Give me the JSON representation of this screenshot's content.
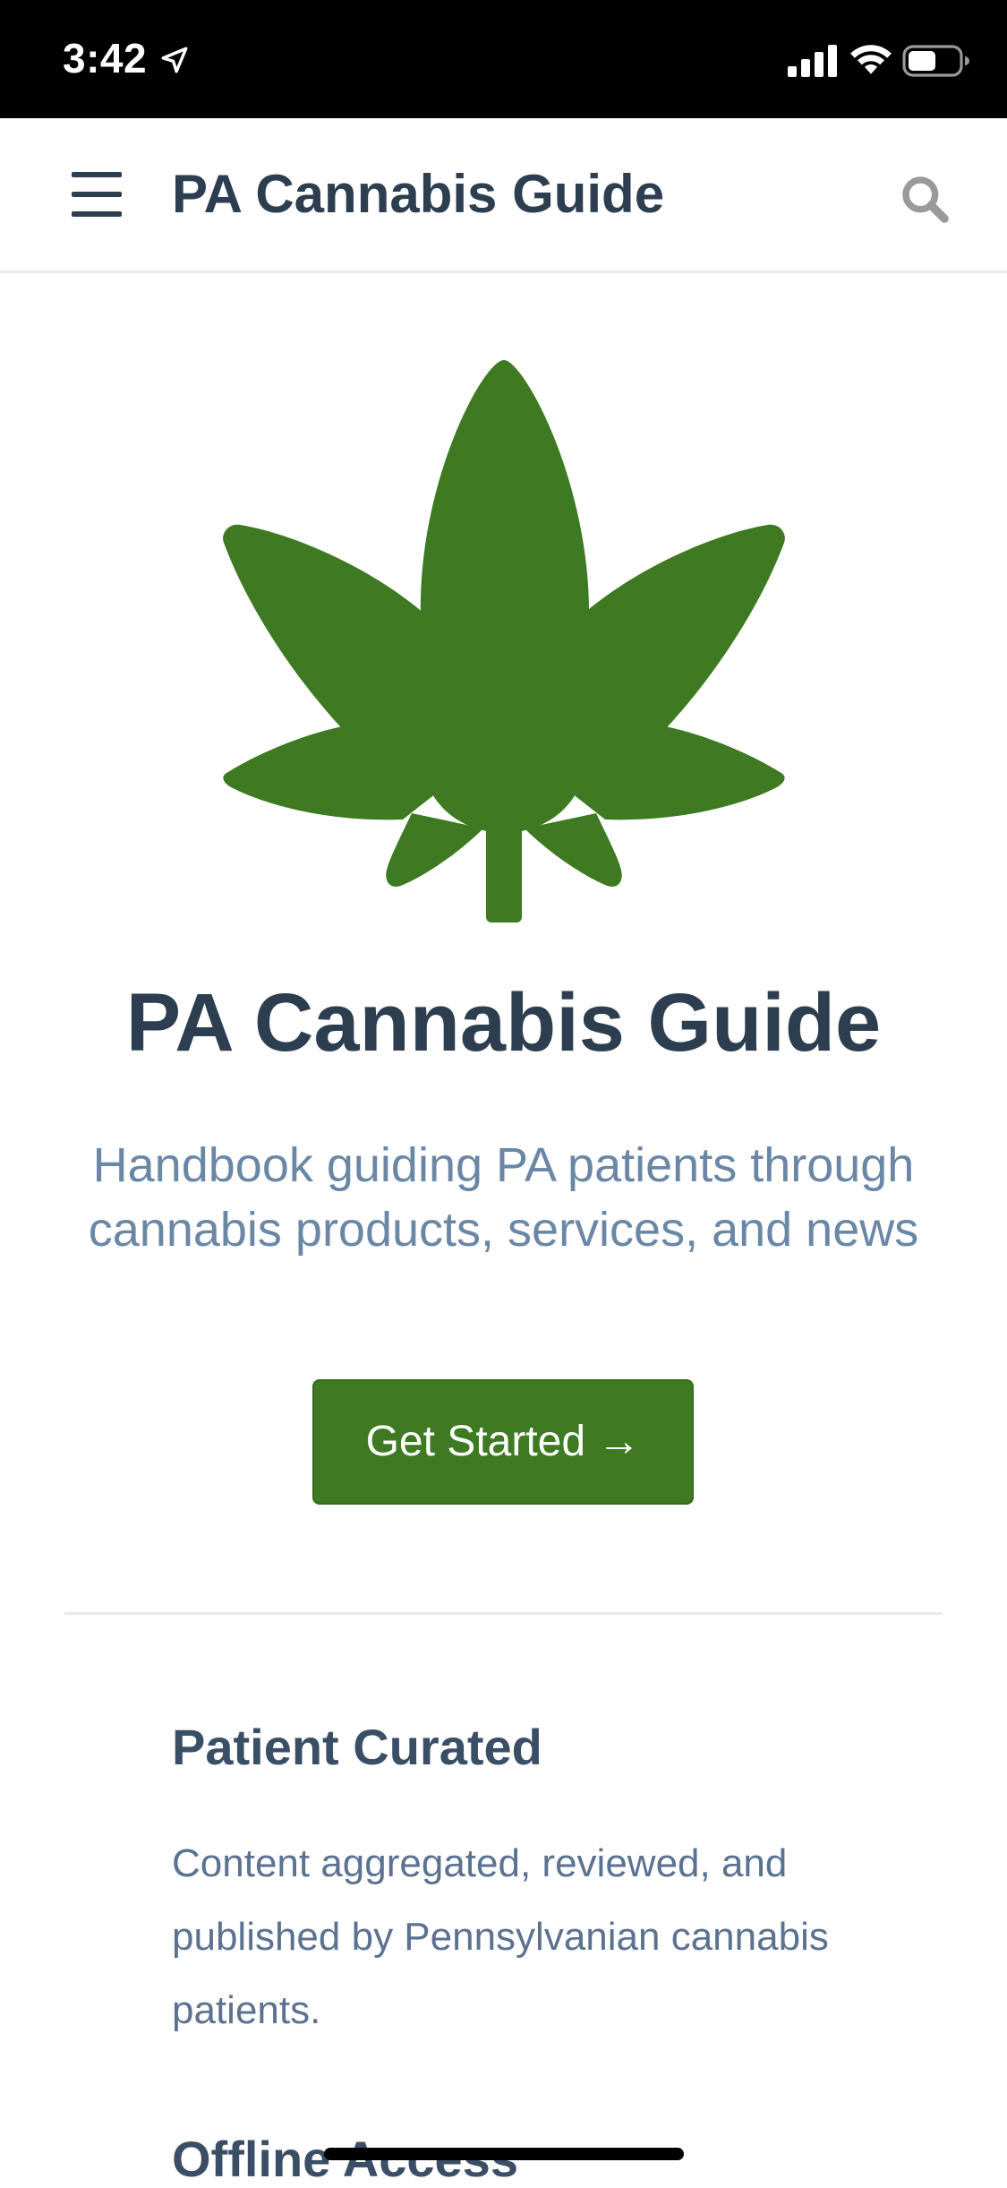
{
  "status_bar": {
    "time": "3:42",
    "icons": [
      "location-arrow-icon",
      "signal-icon",
      "wifi-icon",
      "battery-icon"
    ]
  },
  "nav": {
    "title": "PA Cannabis Guide",
    "menu_icon": "hamburger-menu-icon",
    "search_icon": "search-icon"
  },
  "hero": {
    "logo": "cannabis-leaf-icon",
    "title": "PA Cannabis Guide",
    "description": "Handbook guiding PA patients through cannabis products, services, and news",
    "cta_label": "Get Started →"
  },
  "features": [
    {
      "title": "Patient Curated",
      "description": "Content aggregated, reviewed, and published by Pennsylvanian cannabis patients."
    },
    {
      "title": "Offline Access"
    }
  ],
  "colors": {
    "brand_green": "#3e7a22",
    "heading": "#2c3e50",
    "muted_text": "#6a87a6"
  }
}
